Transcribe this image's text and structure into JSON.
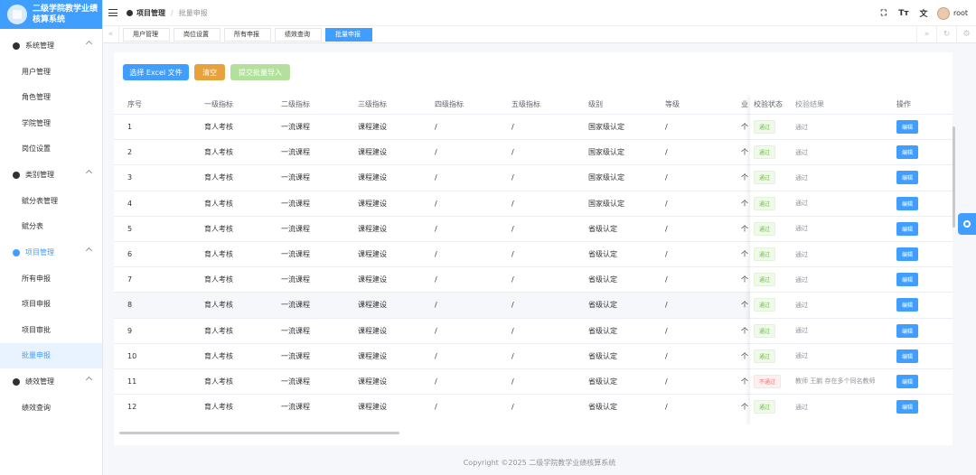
{
  "app": {
    "title": "二级学院教学业绩核算系统"
  },
  "sidebar": {
    "groups": [
      {
        "label": "系统管理",
        "items": [
          "用户管理",
          "角色管理",
          "学院管理",
          "岗位设置"
        ]
      },
      {
        "label": "类别管理",
        "items": [
          "赋分表管理",
          "赋分表"
        ]
      },
      {
        "label": "项目管理",
        "items": [
          "所有申报",
          "项目申报",
          "项目审批",
          "批量申报"
        ]
      },
      {
        "label": "绩效管理",
        "items": [
          "绩效查询"
        ]
      }
    ]
  },
  "header": {
    "crumb1": "项目管理",
    "crumb2": "批量申报",
    "user": "root",
    "icons": [
      "fullscreen-icon",
      "font-size-icon",
      "translate-icon"
    ]
  },
  "tabs": [
    "用户管理",
    "岗位设置",
    "所有申报",
    "绩效查询",
    "批量申报"
  ],
  "buttons": {
    "select": "选择 Excel 文件",
    "clear": "清空",
    "submit": "提交批量导入"
  },
  "table": {
    "headers": [
      "序号",
      "一级指标",
      "二级指标",
      "三级指标",
      "四级指标",
      "五级指标",
      "级别",
      "等级",
      "业"
    ],
    "fixed_headers": [
      "校验状态",
      "校验结果",
      "操作"
    ],
    "rows": [
      [
        "1",
        "育人考核",
        "一流课程",
        "课程建设",
        "/",
        "/",
        "国家级认定",
        "/",
        "个,"
      ],
      [
        "2",
        "育人考核",
        "一流课程",
        "课程建设",
        "/",
        "/",
        "国家级认定",
        "/",
        "个,"
      ],
      [
        "3",
        "育人考核",
        "一流课程",
        "课程建设",
        "/",
        "/",
        "国家级认定",
        "/",
        "个,"
      ],
      [
        "4",
        "育人考核",
        "一流课程",
        "课程建设",
        "/",
        "/",
        "国家级认定",
        "/",
        "个,"
      ],
      [
        "5",
        "育人考核",
        "一流课程",
        "课程建设",
        "/",
        "/",
        "省级认定",
        "/",
        "个,"
      ],
      [
        "6",
        "育人考核",
        "一流课程",
        "课程建设",
        "/",
        "/",
        "省级认定",
        "/",
        "个,"
      ],
      [
        "7",
        "育人考核",
        "一流课程",
        "课程建设",
        "/",
        "/",
        "省级认定",
        "/",
        "个,"
      ],
      [
        "8",
        "育人考核",
        "一流课程",
        "课程建设",
        "/",
        "/",
        "省级认定",
        "/",
        "个,"
      ],
      [
        "9",
        "育人考核",
        "一流课程",
        "课程建设",
        "/",
        "/",
        "省级认定",
        "/",
        "个,"
      ],
      [
        "10",
        "育人考核",
        "一流课程",
        "课程建设",
        "/",
        "/",
        "省级认定",
        "/",
        "个,"
      ],
      [
        "11",
        "育人考核",
        "一流课程",
        "课程建设",
        "/",
        "/",
        "省级认定",
        "/",
        "个,"
      ],
      [
        "12",
        "育人考核",
        "一流课程",
        "课程建设",
        "/",
        "/",
        "省级认定",
        "/",
        "个,"
      ]
    ],
    "status": [
      "通过",
      "通过",
      "通过",
      "通过",
      "通过",
      "通过",
      "通过",
      "通过",
      "通过",
      "通过",
      "不通过",
      "通过"
    ],
    "results": [
      "通过",
      "通过",
      "通过",
      "通过",
      "通过",
      "通过",
      "通过",
      "通过",
      "通过",
      "通过",
      "教师 王鹏 存在多个同名教师",
      "通过"
    ],
    "action": "编辑"
  },
  "footer": "Copyright ©2025 二级学院教学业绩核算系统",
  "colors": {
    "primary": "#409eff",
    "warning": "#e6a23c",
    "success": "#67c23a",
    "danger": "#f56c6c"
  }
}
